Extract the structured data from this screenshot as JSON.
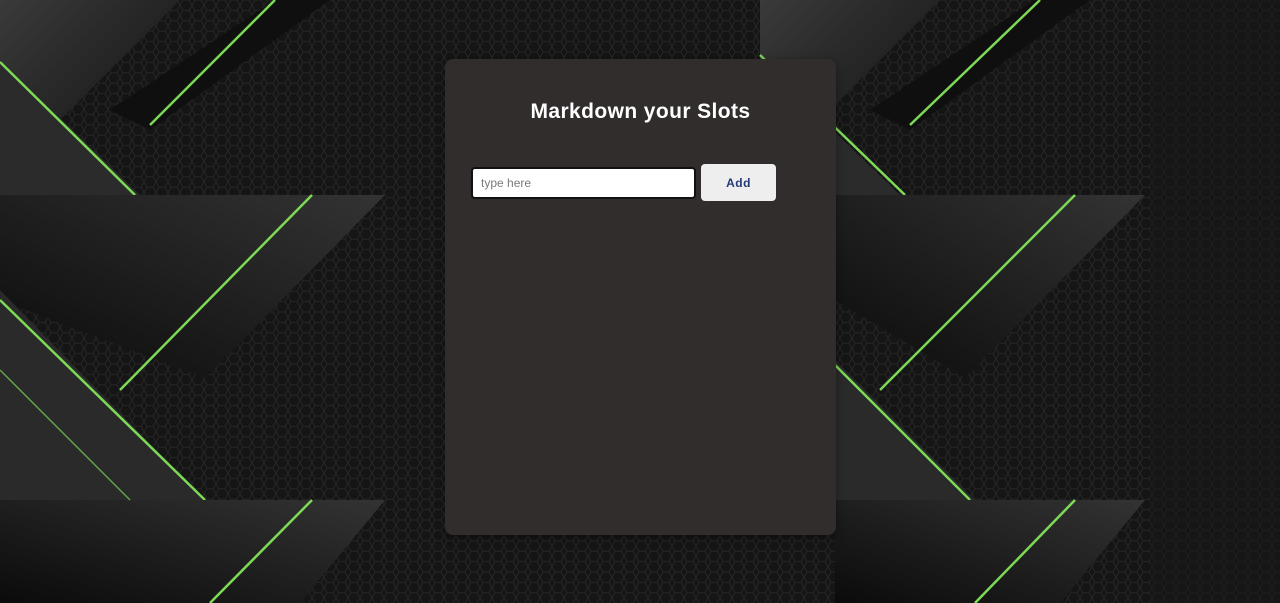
{
  "card": {
    "title": "Markdown your Slots"
  },
  "form": {
    "input_value": "",
    "input_placeholder": "type here",
    "add_label": "Add"
  },
  "slots": [],
  "colors": {
    "card_background": "#302d2c",
    "accent_green": "#7ed957",
    "button_text": "#233a75",
    "button_background": "#eeeeee"
  }
}
